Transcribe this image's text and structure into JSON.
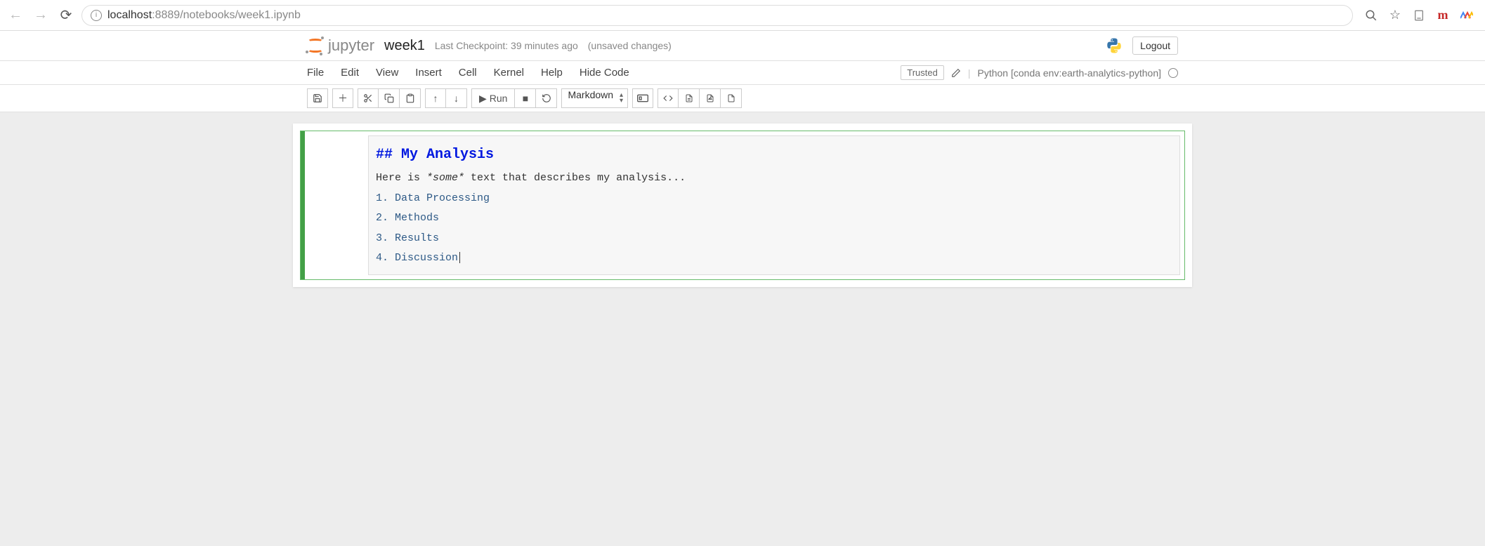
{
  "browser": {
    "url_host": "localhost",
    "url_port": ":8889",
    "url_path": "/notebooks/week1.ipynb"
  },
  "header": {
    "logo_text": "jupyter",
    "notebook_name": "week1",
    "checkpoint": "Last Checkpoint: 39 minutes ago",
    "unsaved": "(unsaved changes)",
    "logout": "Logout"
  },
  "menubar": {
    "items": [
      "File",
      "Edit",
      "View",
      "Insert",
      "Cell",
      "Kernel",
      "Help",
      "Hide Code"
    ],
    "trusted": "Trusted",
    "kernel": "Python [conda env:earth-analytics-python]"
  },
  "toolbar": {
    "run": "Run",
    "cell_type": "Markdown"
  },
  "cell": {
    "heading": "## My Analysis",
    "body_before": "Here is ",
    "body_emph": "*some*",
    "body_after": " text that describes my analysis...",
    "list": [
      "1. Data Processing",
      "2. Methods",
      "3. Results",
      "4. Discussion"
    ]
  }
}
